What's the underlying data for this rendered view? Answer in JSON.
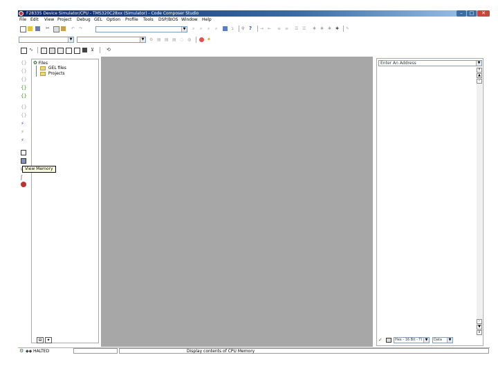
{
  "window": {
    "title": "F28335 Device Simulator/CPU - TMS320C28xx (Simulator) - Code Composer Studio"
  },
  "menu": [
    "File",
    "Edit",
    "View",
    "Project",
    "Debug",
    "GEL",
    "Option",
    "Profile",
    "Tools",
    "DSP/BIOS",
    "Window",
    "Help"
  ],
  "tree": {
    "root": "Files",
    "children": [
      "GEL files",
      "Projects"
    ]
  },
  "tooltip": "View Memory",
  "memory": {
    "address_placeholder": "Enter An Address",
    "page_value": "Hex - 16 Bit - TI Style",
    "format_value": "Data"
  },
  "status": {
    "state": "HALTED",
    "message": "Display contents of CPU Memory"
  },
  "colors": {
    "titlebar": "#0a246a",
    "workspace": "#a7a7a7",
    "tooltip_bg": "#ffffe1"
  }
}
